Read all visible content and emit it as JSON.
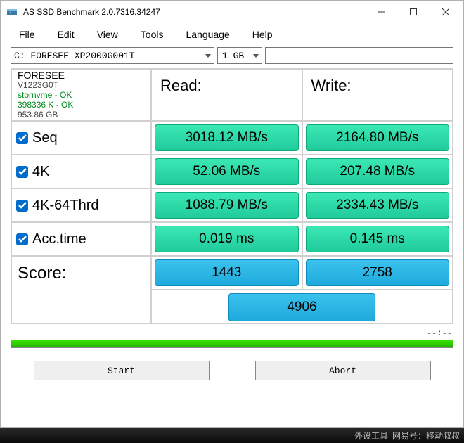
{
  "title": "AS SSD Benchmark 2.0.7316.34247",
  "menu": {
    "file": "File",
    "edit": "Edit",
    "view": "View",
    "tools": "Tools",
    "language": "Language",
    "help": "Help"
  },
  "drive": "C: FORESEE XP2000G001T",
  "size": "1 GB",
  "info": {
    "model": "FORESEE",
    "version": "V1223G0T",
    "driver": "stornvme - OK",
    "align": "398336 K - OK",
    "capacity": "953.86 GB"
  },
  "headers": {
    "read": "Read:",
    "write": "Write:"
  },
  "tests": {
    "seq": {
      "label": "Seq",
      "read": "3018.12 MB/s",
      "write": "2164.80 MB/s"
    },
    "k4": {
      "label": "4K",
      "read": "52.06 MB/s",
      "write": "207.48 MB/s"
    },
    "k4_64": {
      "label": "4K-64Thrd",
      "read": "1088.79 MB/s",
      "write": "2334.43 MB/s"
    },
    "acc": {
      "label": "Acc.time",
      "read": "0.019 ms",
      "write": "0.145 ms"
    }
  },
  "score": {
    "label": "Score:",
    "read": "1443",
    "write": "2758",
    "total": "4906"
  },
  "progress": "--:--",
  "buttons": {
    "start": "Start",
    "abort": "Abort"
  },
  "footer": {
    "left": "外设工具",
    "right": "网易号：移动叔叔"
  }
}
